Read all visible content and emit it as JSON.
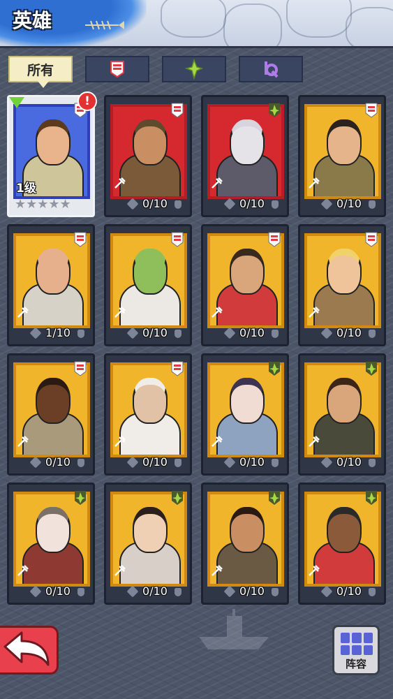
{
  "header": {
    "title": "英雄"
  },
  "tabs": [
    {
      "label": "所有",
      "active": true,
      "icon": ""
    },
    {
      "label": "",
      "active": false,
      "icon": "red-faction-icon",
      "color": "#e23a46"
    },
    {
      "label": "",
      "active": false,
      "icon": "green-faction-icon",
      "color": "#a6d84a"
    },
    {
      "label": "",
      "active": false,
      "icon": "purple-faction-icon",
      "color": "#b07be8"
    }
  ],
  "heroes": [
    {
      "shards": "",
      "level": "1级",
      "selected": true,
      "alert": "!",
      "frame": "blue",
      "faction": "red",
      "skin": "#e9b38c",
      "outfit": "#cfc59a",
      "hair": "#5b3a1e",
      "stars": "★★★★★"
    },
    {
      "shards": "0/10",
      "frame": "red",
      "faction": "red",
      "skin": "#c98f63",
      "outfit": "#7a5a38",
      "hair": "#5e4a2c"
    },
    {
      "shards": "0/10",
      "frame": "red",
      "faction": "green",
      "skin": "#e6e3e8",
      "outfit": "#5d5a6a",
      "hair": "#d9d3dd"
    },
    {
      "shards": "0/10",
      "frame": "yellow",
      "faction": "red",
      "skin": "#e6b48a",
      "outfit": "#8a7a4a",
      "hair": "#2a221c"
    },
    {
      "shards": "1/10",
      "frame": "yellow",
      "faction": "red",
      "skin": "#e7b08c",
      "outfit": "#d6d2c7",
      "hair": "#e7b08c"
    },
    {
      "shards": "0/10",
      "frame": "yellow",
      "faction": "red",
      "skin": "#8fbf5a",
      "outfit": "#ece8e4",
      "hair": "#8fbf5a"
    },
    {
      "shards": "0/10",
      "frame": "yellow",
      "faction": "red",
      "skin": "#d9a57a",
      "outfit": "#d23b3b",
      "hair": "#3a2a1e"
    },
    {
      "shards": "0/10",
      "frame": "yellow",
      "faction": "red",
      "skin": "#f0c49a",
      "outfit": "#9a7a4e",
      "hair": "#f1d16c"
    },
    {
      "shards": "0/10",
      "frame": "yellow",
      "faction": "red",
      "skin": "#6b3f26",
      "outfit": "#a89a7a",
      "hair": "#2a1a12"
    },
    {
      "shards": "0/10",
      "frame": "yellow",
      "faction": "red",
      "skin": "#e2c2a6",
      "outfit": "#f0ece8",
      "hair": "#f0ece8"
    },
    {
      "shards": "0/10",
      "frame": "yellow",
      "faction": "green",
      "skin": "#f0dcd2",
      "outfit": "#8ea3bf",
      "hair": "#3d3450"
    },
    {
      "shards": "0/10",
      "frame": "yellow",
      "faction": "green",
      "skin": "#d9a57a",
      "outfit": "#4a4a3a",
      "hair": "#3a2518"
    },
    {
      "shards": "0/10",
      "frame": "yellow",
      "faction": "green",
      "skin": "#f2e2dc",
      "outfit": "#8e3a32",
      "hair": "#7a7066"
    },
    {
      "shards": "0/10",
      "frame": "yellow",
      "faction": "green",
      "skin": "#f0d0b4",
      "outfit": "#d8d0c8",
      "hair": "#2a1f1a"
    },
    {
      "shards": "0/10",
      "frame": "yellow",
      "faction": "green",
      "skin": "#c98f63",
      "outfit": "#6a5a44",
      "hair": "#2a1a12"
    },
    {
      "shards": "0/10",
      "frame": "yellow",
      "faction": "green",
      "skin": "#8a5a3a",
      "outfit": "#d23b3b",
      "hair": "#2a2a2a"
    }
  ],
  "team_button": {
    "label": "阵容",
    "icon": "grid-icon"
  },
  "back_button": {
    "icon": "back-arrow-icon"
  },
  "colors": {
    "red_faction": "#e23a46",
    "green_faction": "#a6d84a",
    "purple_faction": "#b07be8"
  }
}
